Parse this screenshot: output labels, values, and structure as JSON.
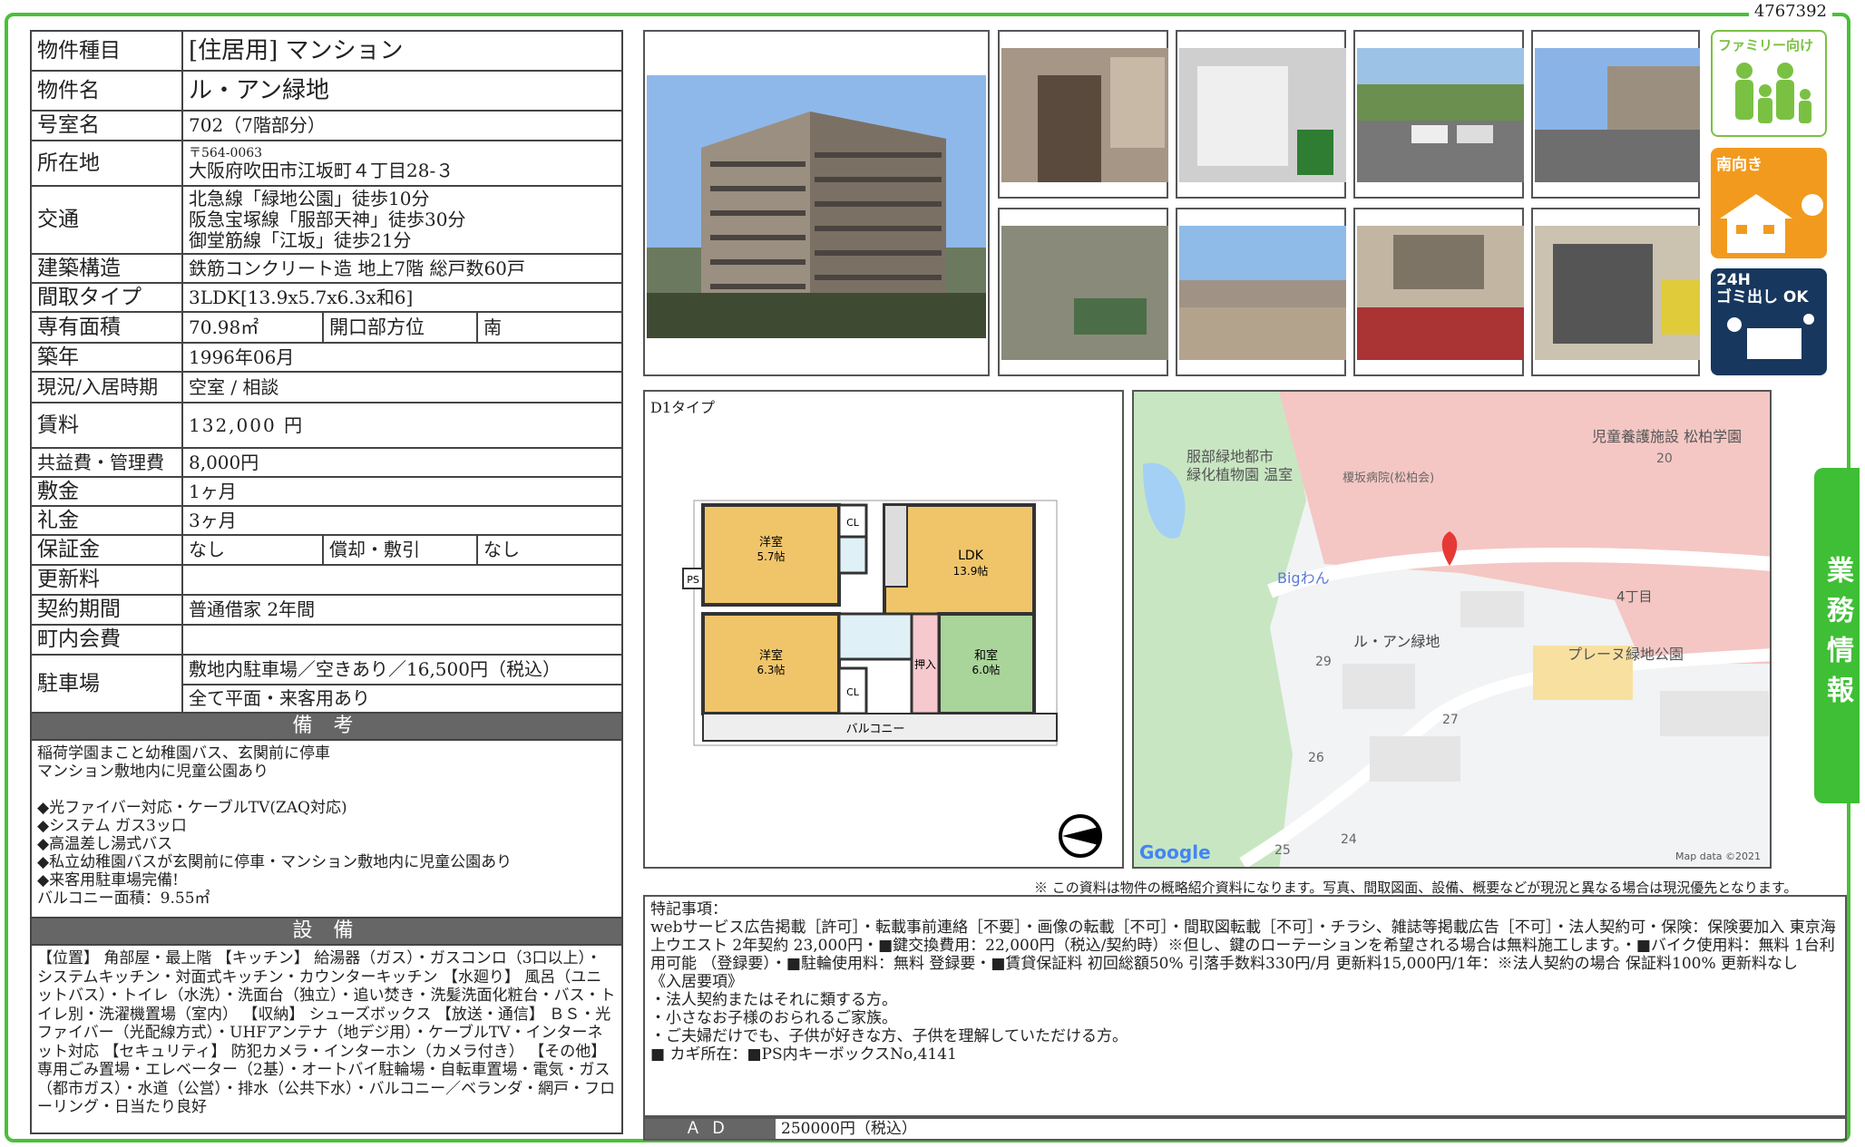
{
  "doc_id": "4767392",
  "spec": {
    "type_label": "物件種目",
    "type_value": "[住居用]  マンション",
    "name_label": "物件名",
    "name_value": "ル・アン緑地",
    "room_label": "号室名",
    "room_value": "702（7階部分）",
    "address_label": "所在地",
    "postal": "〒564-0063",
    "address": "大阪府吹田市江坂町４丁目28-３",
    "access_label": "交通",
    "access": [
      "北急線「緑地公園」徒歩10分",
      "阪急宝塚線「服部天神」徒歩30分",
      "御堂筋線「江坂」徒歩21分"
    ],
    "structure_label": "建築構造",
    "structure_value": "鉄筋コンクリート造 地上7階  総戸数60戸",
    "layout_label": "間取タイプ",
    "layout_value": "3LDK[13.9x5.7x6.3x和6]",
    "area_label": "専有面積",
    "area_value": "70.98㎡",
    "facing_label": "開口部方位",
    "facing_value": "南",
    "built_label": "築年",
    "built_value": "1996年06月",
    "status_label": "現況/入居時期",
    "status_value": "空室 /  相談",
    "rent_label": "賃料",
    "rent_value": "132,000  円",
    "fee_label": "共益費・管理費",
    "fee_value": "8,000円",
    "deposit_label": "敷金",
    "deposit_value": "1ヶ月",
    "keymoney_label": "礼金",
    "keymoney_value": "3ヶ月",
    "guarantee_label": "保証金",
    "guarantee_value": "なし",
    "amort_label": "償却・敷引",
    "amort_value": "なし",
    "renew_label": "更新料",
    "renew_value": "",
    "contract_label": "契約期間",
    "contract_value": "普通借家  2年間",
    "assoc_label": "町内会費",
    "assoc_value": "",
    "parking_label": "駐車場",
    "parking_value1": "敷地内駐車場／空きあり／16,500円（税込）",
    "parking_value2": "全て平面・来客用あり"
  },
  "notes_title": "備 考",
  "notes": "稲荷学園まこと幼稚園バス、玄関前に停車\nマンション敷地内に児童公園あり\n\n◆光ファイバー対応・ケーブルTV(ZAQ対応)\n◆システム ガス3ッ口\n◆高温差し湯式バス\n◆私立幼稚園バスが玄関前に停車・マンション敷地内に児童公園あり\n◆来客用駐車場完備!\nバルコニー面積：9.55㎡",
  "equip_title": "設 備",
  "equip": "【位置】 角部屋・最上階 【キッチン】 給湯器（ガス）・ガスコンロ（3口以上）・システムキッチン・対面式キッチン・カウンターキッチン 【水廻り】 風呂（ユニットバス）・トイレ（水洗）・洗面台（独立）・追い焚き・洗髪洗面化粧台・バス・トイレ別・洗濯機置場（室内） 【収納】 シューズボックス 【放送・通信】 ＢＳ・光ファイバー（光配線方式）・UHFアンテナ（地デジ用）・ケーブルTV・インターネット対応 【セキュリティ】 防犯カメラ・インターホン（カメラ付き） 【その他】 専用ごみ置場・エレベーター（2基）・オートバイ駐輪場・自転車置場・電気・ガス（都市ガス）・水道（公営）・排水（公共下水）・バルコニー／ベランダ・網戸・フローリング・日当たり良好",
  "badges": {
    "family": "ファミリー向け",
    "south": "南向き",
    "garbage": "24H\nゴミ出し OK"
  },
  "business_tab": "業務情報",
  "floorplan": {
    "type_label": "D1タイプ",
    "rooms": {
      "western1": "洋室",
      "western1_size": "5.7帖",
      "western2": "洋室",
      "western2_size": "6.3帖",
      "ldk": "LDK",
      "ldk_size": "13.9帖",
      "japanese": "和室",
      "japanese_size": "6.0帖",
      "closet": "押入",
      "cl1": "CL",
      "cl2": "CL",
      "ps": "PS",
      "balcony": "バルコニー"
    }
  },
  "map": {
    "labels": {
      "park": "服部緑地都市\n緑化植物園 温室",
      "hospital": "榎坂病院(松柏会)",
      "orphanage": "児童養護施設 松柏学園",
      "bigwan": "Bigわん",
      "property": "ル・アン緑地",
      "chome": "4丁目",
      "plaine": "プレーヌ緑地公園",
      "n20": "20",
      "n29": "29",
      "n27": "27",
      "n26": "26",
      "n25": "25",
      "n24": "24",
      "google": "Google",
      "mapdata": "Map data ©2021"
    }
  },
  "disclaimer": "※ この資料は物件の概略紹介資料になります。写真、間取図面、設備、概要などが現況と異なる場合は現況優先となります。",
  "tokki": "特記事項：\nwebサービス広告掲載［許可］・転載事前連絡［不要］・画像の転載［不可］・間取図転載［不可］・チラシ、雑誌等掲載広告［不可］・法人契約可・保険：保険要加入  東京海上ウエスト  2年契約  23,000円・■鍵交換費用：22,000円（税込/契約時）※但し、鍵のローテーションを希望される場合は無料施工します。・■バイク使用料：無料  1台利用可能   （登録要）・■駐輪使用料：無料  登録要・■賃貸保証料  初回総額50%  引落手数料330円/月  更新料15,000円/1年：※法人契約の場合  保証料100%  更新料なし\n《入居要項》\n・法人契約またはそれに類する方。\n・小さなお子様のおられるご家族。\n・ご夫婦だけでも、子供が好きな方、子供を理解していただける方。\n■ カギ所在：■PS内キーボックスNo,4141",
  "ad_label": "ＡＤ",
  "ad_value": "250000円（税込）"
}
